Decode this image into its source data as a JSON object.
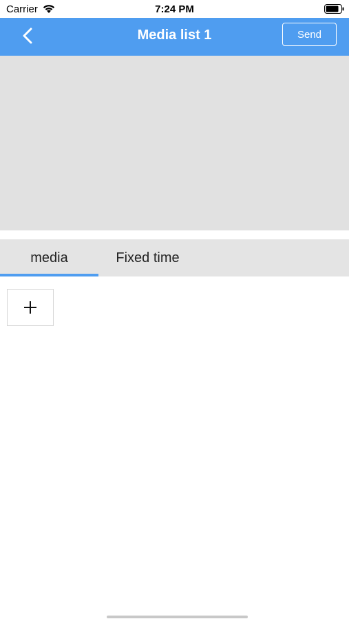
{
  "status_bar": {
    "carrier": "Carrier",
    "time": "7:24 PM",
    "wifi_icon": "wifi-icon",
    "battery_icon": "battery-icon"
  },
  "nav_bar": {
    "title": "Media list 1",
    "back_icon": "chevron-left-icon",
    "send_label": "Send",
    "background_color": "#4f9df0"
  },
  "tabs": [
    {
      "label": "media",
      "active": true
    },
    {
      "label": "Fixed time",
      "active": false
    }
  ],
  "add_button": {
    "icon": "plus-icon"
  },
  "colors": {
    "accent": "#4f9df0",
    "preview_background": "#e1e1e1",
    "tab_bar_background": "#e4e4e4"
  }
}
